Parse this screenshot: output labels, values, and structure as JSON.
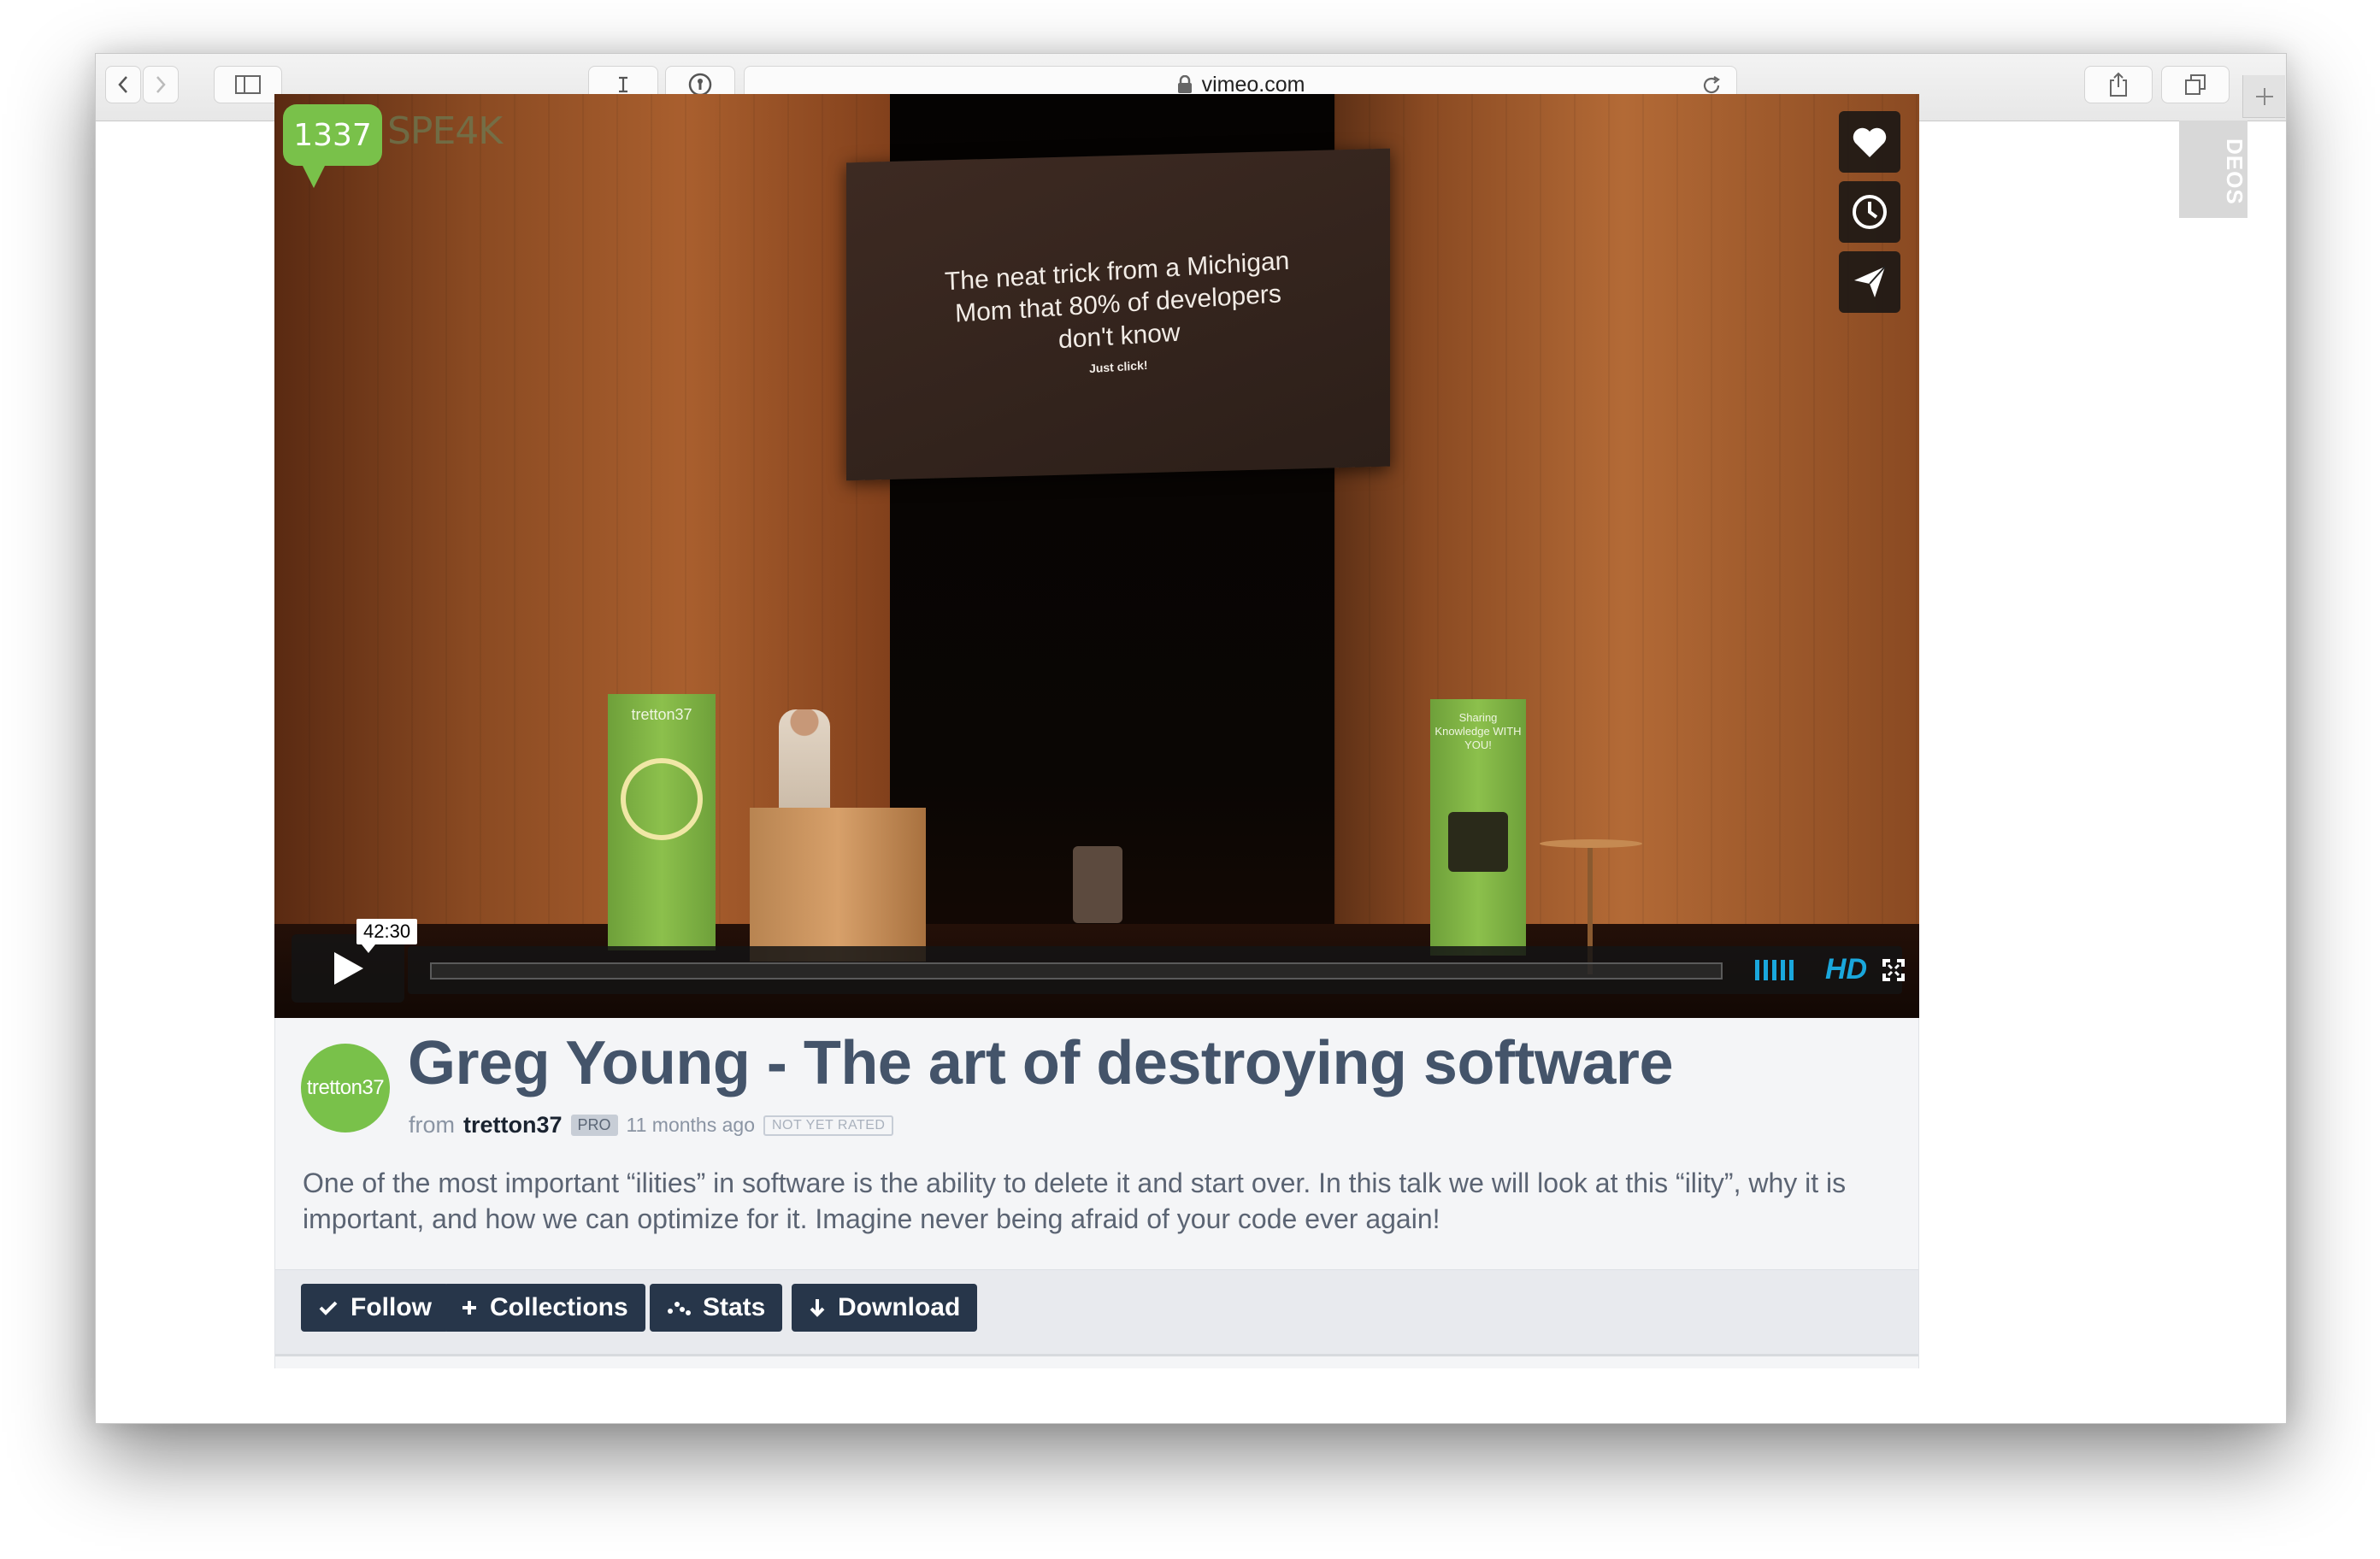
{
  "browser": {
    "url": "vimeo.com",
    "side_tab_label": "DEOS"
  },
  "player": {
    "logo_mark": "1337",
    "logo_word": "SPE4K",
    "slide_text": "The neat trick from a Michigan Mom that 80% of developers don't know",
    "slide_subtext": "Just click!",
    "banner_left_text": "tretton37",
    "banner_right_text": "Sharing Knowledge WITH YOU!",
    "timecode": "42:30",
    "hd_label": "HD",
    "accent_color": "#1aa7dc"
  },
  "video": {
    "avatar_text": "tretton37",
    "title": "Greg Young - The art of destroying software",
    "from_label": "from",
    "owner": "tretton37",
    "owner_badge": "PRO",
    "age": "11 months ago",
    "rating": "NOT YET RATED",
    "description": "One of the most important “ilities” in software is the ability to delete it and start over. In this talk we will look at this “ility”, why it is important, and how we can optimize for it. Imagine never being afraid of your code ever again!"
  },
  "actions": {
    "follow": "Follow",
    "collections": "Collections",
    "stats": "Stats",
    "download": "Download"
  },
  "icons": [
    "back-icon",
    "forward-icon",
    "sidebar-icon",
    "reader-icon",
    "password-icon",
    "lock-icon",
    "reload-icon",
    "share-icon",
    "tabs-icon",
    "plus-icon",
    "heart-icon",
    "clock-icon",
    "send-icon",
    "play-icon",
    "volume-icon",
    "fullscreen-icon",
    "check-icon",
    "add-icon",
    "stats-icon",
    "download-icon"
  ]
}
